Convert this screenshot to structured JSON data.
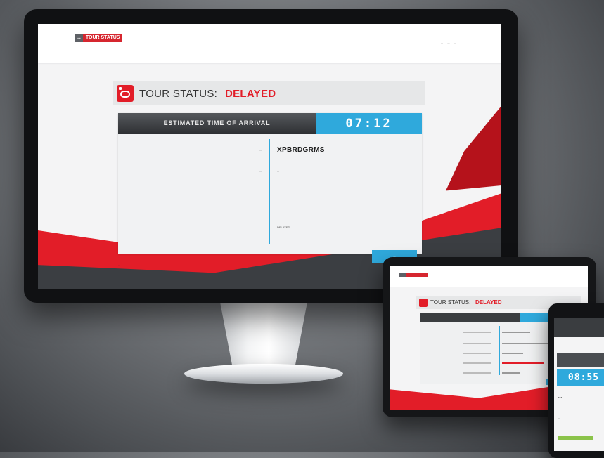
{
  "desktop": {
    "brand": {
      "part1": "...",
      "part2": "TOUR STATUS",
      "tagline": "..."
    },
    "nav": [
      "...",
      "...",
      "..."
    ],
    "status_label": "TOUR STATUS:",
    "status_value": "DELAYED",
    "eta_label": "ESTIMATED TIME OF ARRIVAL",
    "eta_time": "07:12",
    "rows": [
      {
        "label": "...",
        "value": "XPBRDGRMS"
      },
      {
        "label": "...",
        "value": "..."
      },
      {
        "label": "...",
        "value": "..."
      },
      {
        "label": "...",
        "value": "..."
      },
      {
        "label": "...",
        "value": "DELAYED"
      }
    ],
    "footer_lines": [
      "...",
      "..."
    ],
    "more_button": "..."
  },
  "tablet": {
    "status_label": "TOUR STATUS:",
    "status_value": "DELAYED"
  },
  "phone": {
    "eta_time": "08:55",
    "vehicle": "...",
    "lines": [
      "...",
      "...",
      "..."
    ]
  },
  "colors": {
    "accent_red": "#e21d28",
    "accent_blue": "#2fa9dc",
    "dark_bar": "#3a3d40"
  }
}
